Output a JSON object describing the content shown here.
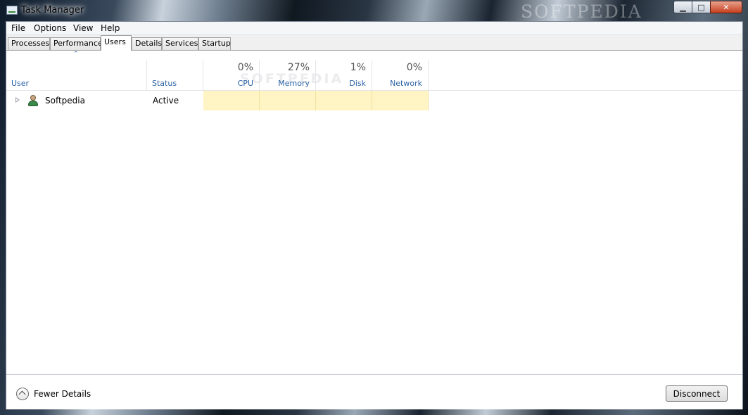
{
  "window": {
    "title": "Task Manager",
    "watermark": "SOFTPEDIA",
    "minimize_glyph": "▁",
    "maximize_glyph": "□",
    "close_glyph": "✕"
  },
  "menu": [
    "File",
    "Options",
    "View",
    "Help"
  ],
  "tabs": [
    "Processes",
    "Performance",
    "Users",
    "Details",
    "Services",
    "Startup"
  ],
  "active_tab": "Users",
  "columns": {
    "user": "User",
    "status": "Status",
    "cpu": {
      "percent": "0%",
      "label": "CPU"
    },
    "memory": {
      "percent": "27%",
      "label": "Memory"
    },
    "disk": {
      "percent": "1%",
      "label": "Disk"
    },
    "network": {
      "percent": "0%",
      "label": "Network"
    }
  },
  "header_watermark": "SOFTPEDIA",
  "users": [
    {
      "name": "Softpedia",
      "status": "Active",
      "icon": "user-icon"
    }
  ],
  "footer": {
    "fewer_details": "Fewer Details",
    "disconnect": "Disconnect"
  },
  "colors": {
    "header_label": "#2b62a4",
    "resource_highlight": "#fff4c4"
  }
}
